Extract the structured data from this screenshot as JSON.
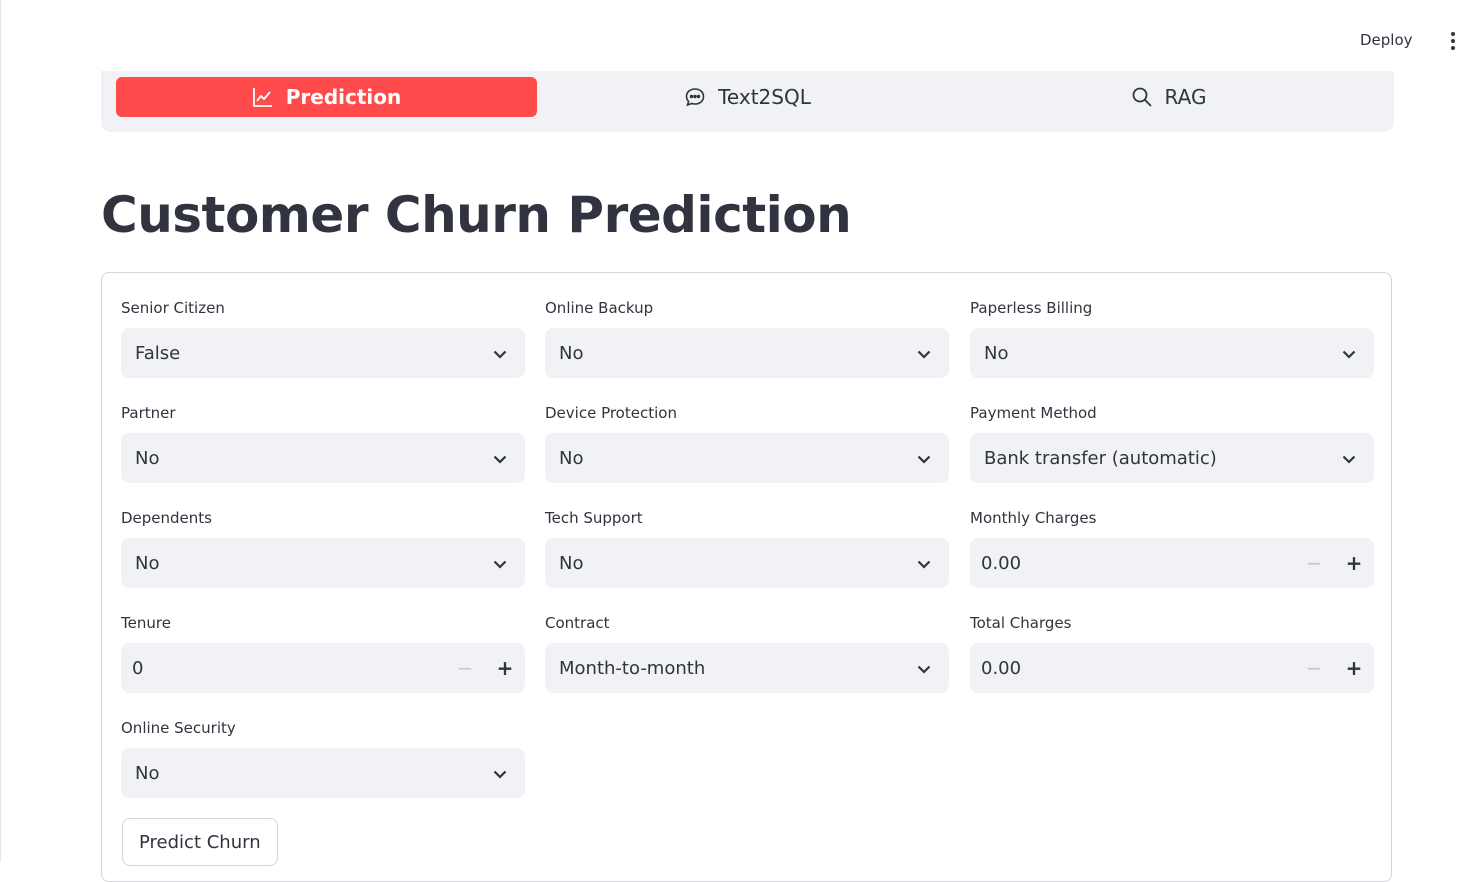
{
  "header": {
    "deploy_label": "Deploy",
    "menu_icon": "kebab-menu-icon"
  },
  "tabs": [
    {
      "label": "Prediction",
      "icon": "line-chart-icon",
      "active": true
    },
    {
      "label": "Text2SQL",
      "icon": "chat-bubble-icon",
      "active": false
    },
    {
      "label": "RAG",
      "icon": "search-icon",
      "active": false
    }
  ],
  "page_title": "Customer Churn Prediction",
  "form": {
    "fields": {
      "senior_citizen": {
        "label": "Senior Citizen",
        "value": "False"
      },
      "partner": {
        "label": "Partner",
        "value": "No"
      },
      "dependents": {
        "label": "Dependents",
        "value": "No"
      },
      "tenure": {
        "label": "Tenure",
        "value": "0"
      },
      "online_security": {
        "label": "Online Security",
        "value": "No"
      },
      "online_backup": {
        "label": "Online Backup",
        "value": "No"
      },
      "device_protection": {
        "label": "Device Protection",
        "value": "No"
      },
      "tech_support": {
        "label": "Tech Support",
        "value": "No"
      },
      "contract": {
        "label": "Contract",
        "value": "Month-to-month"
      },
      "paperless_billing": {
        "label": "Paperless Billing",
        "value": "No"
      },
      "payment_method": {
        "label": "Payment Method",
        "value": "Bank transfer (automatic)"
      },
      "monthly_charges": {
        "label": "Monthly Charges",
        "value": "0.00"
      },
      "total_charges": {
        "label": "Total Charges",
        "value": "0.00"
      }
    },
    "stepper": {
      "minus": "−",
      "plus": "+"
    },
    "submit_label": "Predict Churn"
  },
  "colors": {
    "accent": "#ff4b4b",
    "input_bg": "#f0f2f6",
    "text": "#31333F"
  }
}
